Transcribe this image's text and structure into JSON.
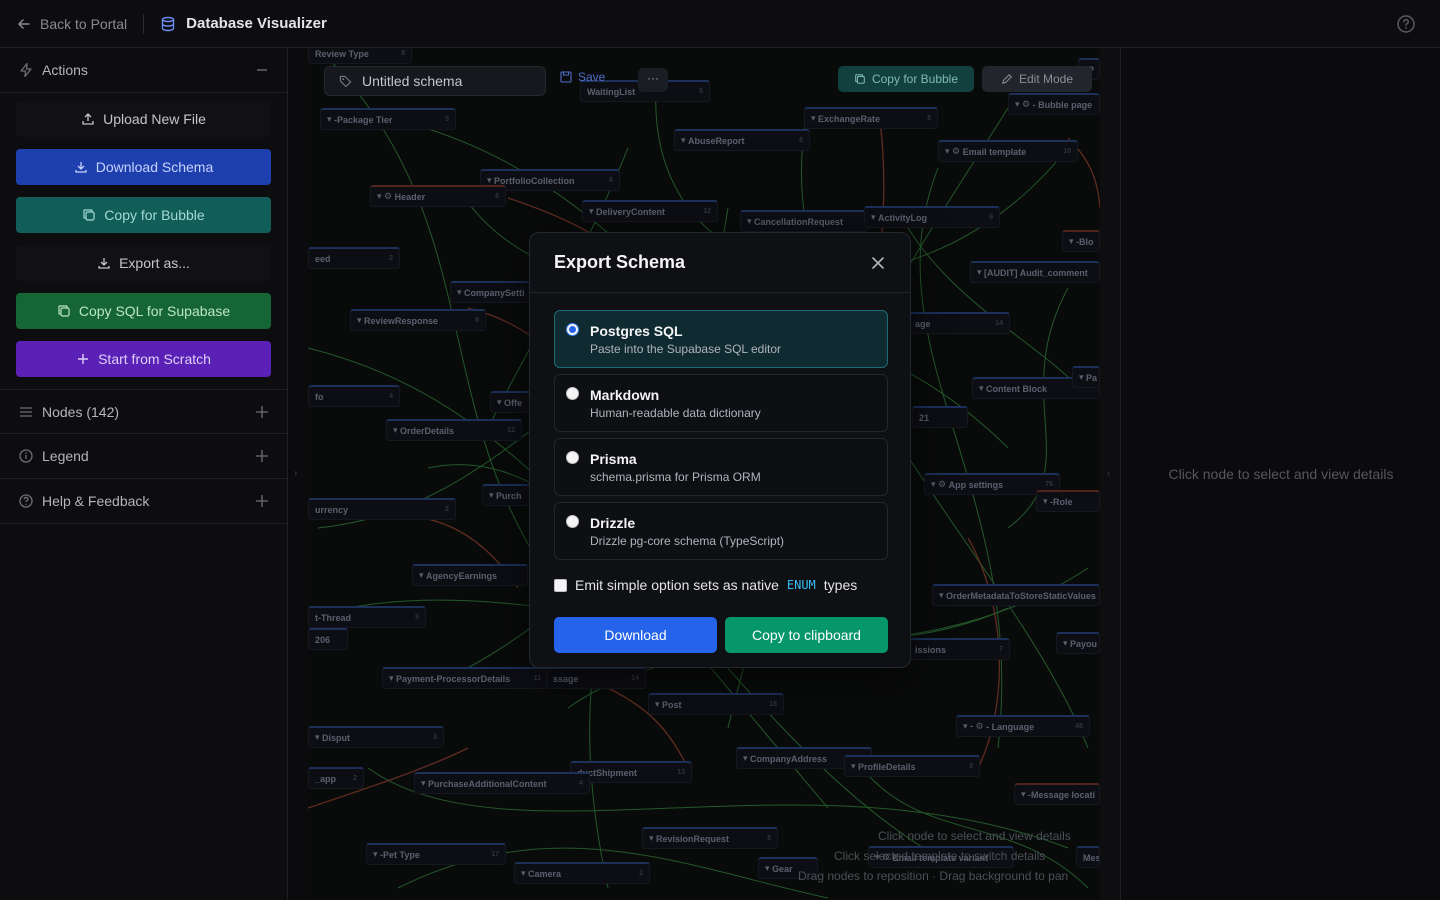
{
  "topbar": {
    "back_label": "Back to Portal",
    "app_title": "Database Visualizer"
  },
  "sidebar": {
    "actions_title": "Actions",
    "actions": {
      "upload": "Upload New File",
      "download_schema": "Download Schema",
      "copy_bubble": "Copy for Bubble",
      "export_as": "Export as...",
      "copy_sql": "Copy SQL for Supabase",
      "scratch": "Start from Scratch"
    },
    "nodes_title": "Nodes (142)",
    "legend_title": "Legend",
    "help_title": "Help & Feedback"
  },
  "canvas": {
    "schema_name": "Untitled schema",
    "save_label": "Save",
    "more_label": "···",
    "copy_bubble_label": "Copy for Bubble",
    "edit_mode_label": "Edit Mode",
    "hint_select": "Click node to select and view details",
    "hint_switch": "Click selected template to switch details",
    "hint_drag": "Drag nodes to reposition · Drag background to pan",
    "nodes": [
      {
        "label": "Review Type",
        "count": "8"
      },
      {
        "label": "WaitingList",
        "count": "5"
      },
      {
        "label": "-Package Tier",
        "count": "5"
      },
      {
        "label": "AbuseReport",
        "count": "8"
      },
      {
        "label": "ExchangeRate",
        "count": "5"
      },
      {
        "label": "Email template",
        "count": "10"
      },
      {
        "label": "- Bubble page",
        "count": ""
      },
      {
        "label": "PortfolioCollection",
        "count": "6"
      },
      {
        "label": "Header",
        "count": "6"
      },
      {
        "label": "DeliveryContent",
        "count": "12"
      },
      {
        "label": "CancellationRequest",
        "count": ""
      },
      {
        "label": "ActivityLog",
        "count": "9"
      },
      {
        "label": "-Blo",
        "count": ""
      },
      {
        "label": "[AUDIT] Audit_comment",
        "count": ""
      },
      {
        "label": "eed",
        "count": "2"
      },
      {
        "label": "CompanySetti",
        "count": ""
      },
      {
        "label": "ReviewResponse",
        "count": "8"
      },
      {
        "label": "age",
        "count": "14"
      },
      {
        "label": "Content Block",
        "count": ""
      },
      {
        "label": "Pa",
        "count": ""
      },
      {
        "label": "fo",
        "count": "4"
      },
      {
        "label": "Offe",
        "count": ""
      },
      {
        "label": "OrderDetails",
        "count": "12"
      },
      {
        "label": "21",
        "count": ""
      },
      {
        "label": "App settings",
        "count": "76"
      },
      {
        "label": "Purch",
        "count": ""
      },
      {
        "label": "-Role",
        "count": ""
      },
      {
        "label": "urrency",
        "count": "2"
      },
      {
        "label": "AgencyEarnings",
        "count": ""
      },
      {
        "label": "OrderMetadataToStoreStaticValues",
        "count": ""
      },
      {
        "label": "t-Thread",
        "count": "5"
      },
      {
        "label": "issions",
        "count": "7"
      },
      {
        "label": "Payou",
        "count": ""
      },
      {
        "label": "Payment-ProcessorDetails",
        "count": "11"
      },
      {
        "label": "ssage",
        "count": "14"
      },
      {
        "label": "Post",
        "count": "18"
      },
      {
        "label": "- Language",
        "count": "48"
      },
      {
        "label": "Disput",
        "count": "3"
      },
      {
        "label": "CompanyAddress",
        "count": ""
      },
      {
        "label": "ProfileDetails",
        "count": "3"
      },
      {
        "label": "ductShipment",
        "count": "13"
      },
      {
        "label": "_app",
        "count": "2"
      },
      {
        "label": "PurchaseAdditionalContent",
        "count": "4"
      },
      {
        "label": "-Message locati",
        "count": ""
      },
      {
        "label": "RevisionRequest",
        "count": "5"
      },
      {
        "label": "-Pet Type",
        "count": "17"
      },
      {
        "label": "Email template variant",
        "count": ""
      },
      {
        "label": "Gear",
        "count": ""
      },
      {
        "label": "Camera",
        "count": "2"
      },
      {
        "label": "Mes",
        "count": ""
      },
      {
        "label": "-P",
        "count": ""
      },
      {
        "label": "206",
        "count": ""
      }
    ]
  },
  "right_panel": {
    "empty_message": "Click node to select and view details"
  },
  "modal": {
    "title": "Export Schema",
    "options": [
      {
        "label": "Postgres SQL",
        "desc": "Paste into the Supabase SQL editor",
        "selected": true
      },
      {
        "label": "Markdown",
        "desc": "Human-readable data dictionary",
        "selected": false
      },
      {
        "label": "Prisma",
        "desc": "schema.prisma for Prisma ORM",
        "selected": false
      },
      {
        "label": "Drizzle",
        "desc": "Drizzle pg-core schema (TypeScript)",
        "selected": false
      }
    ],
    "checkbox_pre": "Emit simple option sets as native",
    "checkbox_code": "ENUM",
    "checkbox_post": "types",
    "download_label": "Download",
    "copy_label": "Copy to clipboard"
  },
  "colors": {
    "accent_blue": "#2563eb",
    "accent_green": "#059669",
    "edge_green": "#3f9d4a",
    "edge_red": "#a24a36"
  }
}
